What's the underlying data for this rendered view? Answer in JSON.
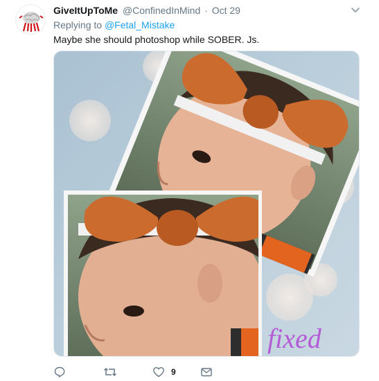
{
  "tweet": {
    "display_name": "GiveItUpToMe",
    "handle": "@ConfinedInMind",
    "separator": "·",
    "time": "Oct 29",
    "reply_prefix": "Replying to",
    "reply_to": "@Fetal_Mistake",
    "text": "Maybe she should photoshop while SOBER. Js.",
    "overlay_text": "fixed",
    "actions": {
      "reply_icon": "reply-icon",
      "retweet_icon": "retweet-icon",
      "like_icon": "heart-icon",
      "like_count": "9",
      "message_icon": "envelope-icon"
    }
  },
  "colors": {
    "link": "#1da1f2",
    "secondary_text": "#657786",
    "overlay_text": "#b45cd6"
  }
}
